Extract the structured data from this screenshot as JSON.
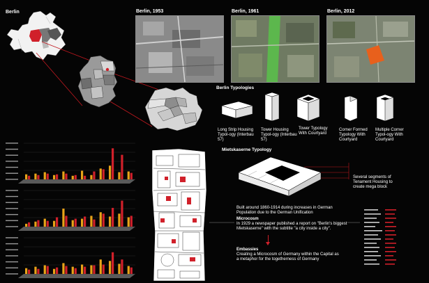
{
  "labels": {
    "map_title": "Berlin",
    "photo_1953": "Berlin, 1953",
    "photo_1961": "Berlin, 1961",
    "photo_2012": "Berlin, 2012",
    "typologies_title": "Berlin Typologies",
    "miets_title": "Mietskaserne Typology",
    "segments_note": "Several segments of Tenament Housing to create mega block",
    "desc_built": "Built around 1860-1914 during increases in German Population due to the German Unification",
    "desc_microcosm_head": "Microcosm",
    "desc_microcosm_body": "In 1929 a newspaper published a report on \"Berlin's biggest Mietskaserne\" with the subtitle \"a city inside a city\".",
    "desc_embassies_head": "Embassies",
    "desc_embassies_body": "Creating a Microcosm of Germany within the Capital as a metaphor for the togetherness of Germany"
  },
  "typologies": [
    {
      "label": "Long Strip Housing Typol-ogy (Interbau 57)"
    },
    {
      "label": "Tower Housing Typol-ogy (Interbau 57)"
    },
    {
      "label": "Tower Typology With Courtyard"
    },
    {
      "label": "Corner Formed Typology With Courtyard"
    },
    {
      "label": "Multiple Corner Typol-ogy With Courtyard"
    }
  ],
  "colors": {
    "yellow": "#e8a318",
    "red": "#d0202a",
    "map_grey": "#9a9a9a",
    "orange": "#e8601c"
  },
  "chart_data": [
    {
      "type": "bar",
      "ylim": [
        0,
        100000
      ],
      "series": [
        {
          "name": "",
          "color": "#e8a318",
          "values": [
            14,
            16,
            20,
            12,
            22,
            10,
            24,
            12,
            30,
            38,
            20,
            22
          ]
        },
        {
          "name": "",
          "color": "#d0202a",
          "values": [
            10,
            12,
            16,
            14,
            16,
            12,
            10,
            22,
            28,
            86,
            68,
            18
          ]
        }
      ]
    },
    {
      "type": "bar",
      "ylim": [
        0,
        100000
      ],
      "series": [
        {
          "name": "",
          "color": "#e8a318",
          "values": [
            8,
            14,
            22,
            16,
            50,
            18,
            22,
            30,
            40,
            28,
            36,
            26
          ]
        },
        {
          "name": "",
          "color": "#d0202a",
          "values": [
            12,
            18,
            16,
            26,
            30,
            22,
            28,
            20,
            36,
            52,
            72,
            30
          ]
        }
      ]
    },
    {
      "type": "bar",
      "ylim": [
        0,
        100000
      ],
      "series": [
        {
          "name": "",
          "color": "#e8a318",
          "values": [
            16,
            20,
            24,
            14,
            30,
            20,
            26,
            24,
            40,
            36,
            28,
            22
          ]
        },
        {
          "name": "",
          "color": "#d0202a",
          "values": [
            12,
            14,
            22,
            18,
            22,
            16,
            20,
            24,
            26,
            60,
            40,
            18
          ]
        }
      ]
    }
  ]
}
